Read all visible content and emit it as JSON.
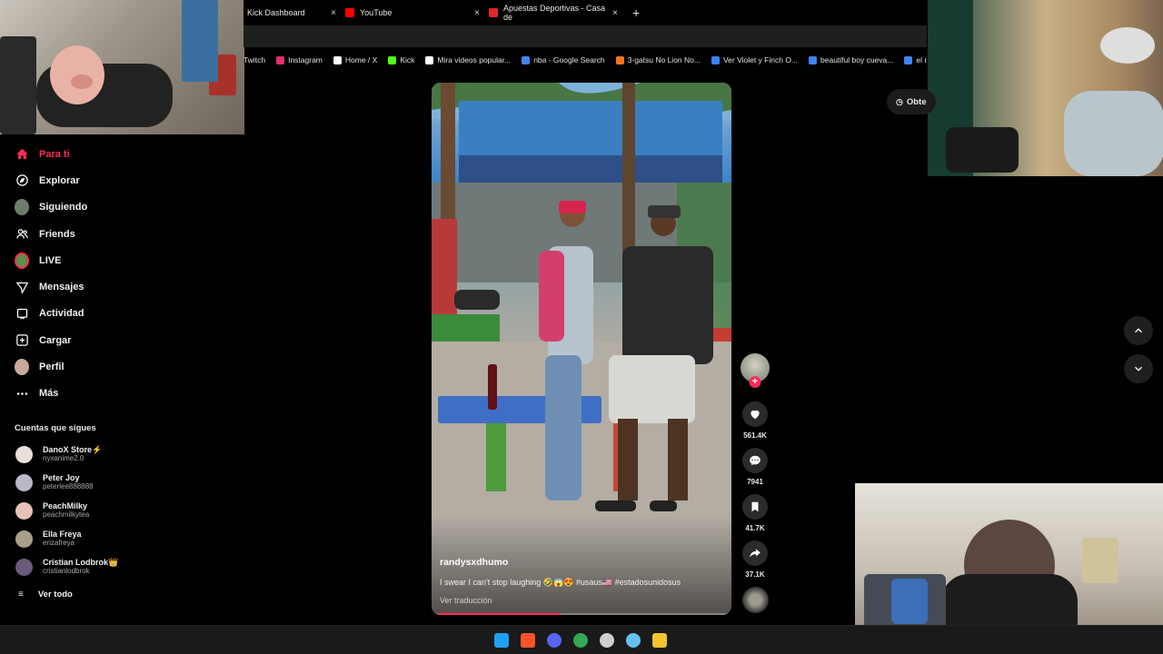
{
  "browser": {
    "tabs": [
      {
        "label": "Kick Dashboard",
        "color": "#53fc18"
      },
      {
        "label": "YouTube",
        "color": "#ff0000"
      },
      {
        "label": "Apuestas Deportivas - Casa de",
        "color": "#e3262a"
      }
    ],
    "close_glyph": "×",
    "new_tab_glyph": "+",
    "bookmarks": [
      {
        "label": "Twitch",
        "icon": "twitch-icon",
        "color": "#9146ff"
      },
      {
        "label": "Instagram",
        "icon": "instagram-icon",
        "color": "#e1306c"
      },
      {
        "label": "Home / X",
        "icon": "x-icon",
        "color": "#ffffff"
      },
      {
        "label": "Kick",
        "icon": "kick-icon",
        "color": "#53fc18"
      },
      {
        "label": "Mira videos popular...",
        "icon": "tiktok-icon",
        "color": "#ffffff"
      },
      {
        "label": "nba - Google Search",
        "icon": "google-icon",
        "color": "#4285f4"
      },
      {
        "label": "3-gatsu No Lion No...",
        "icon": "crunchyroll-icon",
        "color": "#f47521"
      },
      {
        "label": "Ver Violet y Finch O...",
        "icon": "site-icon",
        "color": "#3b82f6"
      },
      {
        "label": "beautiful boy cueva...",
        "icon": "google-icon",
        "color": "#4285f4"
      },
      {
        "label": "el mundo",
        "icon": "google-icon",
        "color": "#4285f4"
      }
    ]
  },
  "sidebar": {
    "nav": [
      {
        "label": "Para ti",
        "icon": "home-icon",
        "active": true
      },
      {
        "label": "Explorar",
        "icon": "compass-icon"
      },
      {
        "label": "Siguiendo",
        "icon": "following-avatar-icon"
      },
      {
        "label": "Friends",
        "icon": "friends-icon"
      },
      {
        "label": "LIVE",
        "icon": "live-avatar-icon"
      },
      {
        "label": "Mensajes",
        "icon": "send-icon"
      },
      {
        "label": "Actividad",
        "icon": "activity-icon"
      },
      {
        "label": "Cargar",
        "icon": "upload-icon"
      },
      {
        "label": "Perfil",
        "icon": "profile-avatar-icon"
      },
      {
        "label": "Más",
        "icon": "more-icon"
      }
    ],
    "following_title": "Cuentas que sigues",
    "following": [
      {
        "name": "DanoX Store⚡",
        "handle": "nyxanime2.0",
        "color": "#e8e0d8"
      },
      {
        "name": "Peter Joy",
        "handle": "peterlee888888",
        "color": "#b8b8c8"
      },
      {
        "name": "PeachMilky",
        "handle": "peachmilkytea",
        "color": "#e7c3b6"
      },
      {
        "name": "Ella Freya",
        "handle": "erizafreya",
        "color": "#a8a088"
      },
      {
        "name": "Cristian Lodbrok👑",
        "handle": "cristianlodbrok",
        "color": "#6b5a7a"
      }
    ],
    "see_all": "Ver todo",
    "see_all_icon": "≡"
  },
  "video": {
    "username": "randysxdhumo",
    "caption": "I swear I can't stop laughing 🤣😱😍 #usaus🇺🇸 #estadosunidosus",
    "translate": "Ver traducción",
    "progress": 0.43
  },
  "actions": {
    "likes": "561.4K",
    "comments": "7941",
    "saves": "41.7K",
    "shares": "37.1K",
    "follow_plus": "+"
  },
  "get_app": {
    "label": "Obte",
    "icon": "clock-icon"
  },
  "taskbar_icons": [
    {
      "name": "windows-start-icon",
      "color": "#1ea1f1"
    },
    {
      "name": "brave-icon",
      "color": "#fb542b"
    },
    {
      "name": "discord-icon",
      "color": "#5865f2"
    },
    {
      "name": "chrome-icon",
      "color": "#34a853"
    },
    {
      "name": "obs-icon",
      "color": "#cfcfcf"
    },
    {
      "name": "steam-icon",
      "color": "#66c0f4"
    },
    {
      "name": "app-icon",
      "color": "#f4c430"
    }
  ]
}
